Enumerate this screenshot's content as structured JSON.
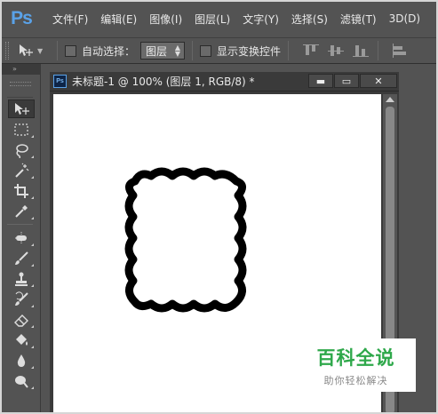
{
  "app": {
    "logo": "Ps"
  },
  "menu": [
    "文件(F)",
    "编辑(E)",
    "图像(I)",
    "图层(L)",
    "文字(Y)",
    "选择(S)",
    "滤镜(T)",
    "3D(D)"
  ],
  "options": {
    "auto_select_label": "自动选择：",
    "auto_select_value": "图层",
    "show_transform_label": "显示变换控件"
  },
  "toolbar": {
    "collapse": "»",
    "tools": [
      "move-icon",
      "rect-marquee-icon",
      "lasso-icon",
      "magic-wand-icon",
      "crop-icon",
      "eyedropper-icon",
      "spot-heal-icon",
      "brush-icon",
      "clone-stamp-icon",
      "history-brush-icon",
      "eraser-icon",
      "paint-bucket-icon",
      "blur-icon",
      "dodge-icon"
    ]
  },
  "document": {
    "ps_badge": "Ps",
    "title": "未标题-1 @ 100% (图层 1, RGB/8) *",
    "minimize": "▬",
    "maximize": "▭",
    "close": "✕"
  },
  "watermark": {
    "title": "百科全说",
    "subtitle": "助你轻松解决"
  },
  "colors": {
    "ui_bg": "#535353",
    "canvas": "#ffffff",
    "accent": "#5aa2e8",
    "watermark_green": "#2ea84a"
  }
}
